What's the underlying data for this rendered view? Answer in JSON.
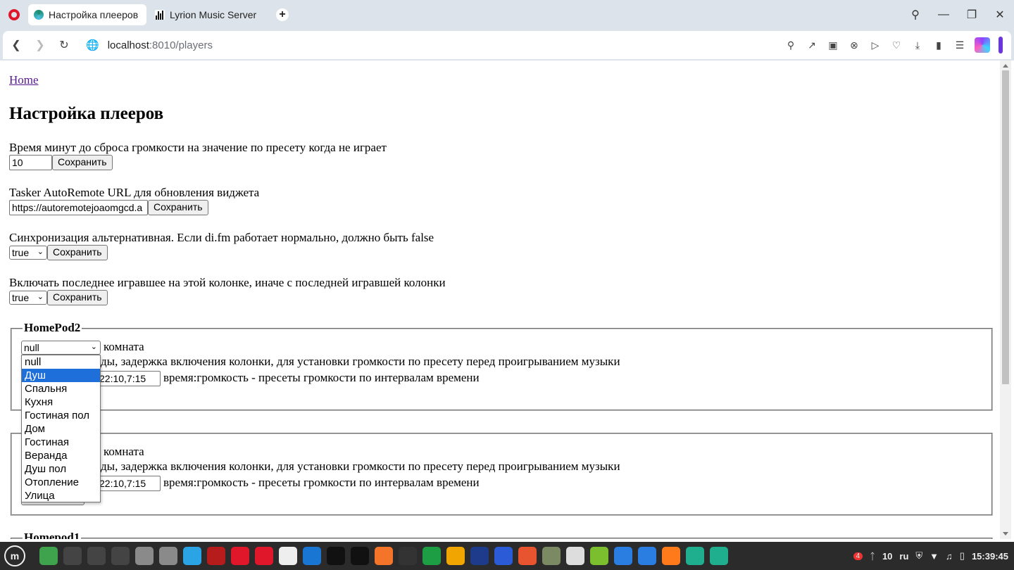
{
  "browser": {
    "tabs": [
      {
        "title": "Настройка плееров",
        "active": true
      },
      {
        "title": "Lyrion Music Server",
        "active": false
      }
    ],
    "url_host": "localhost",
    "url_rest": ":8010/players"
  },
  "page": {
    "home_link": "Home",
    "title": "Настройка плееров",
    "settings": [
      {
        "label": "Время минут до сброса громкости на значение по пресету когда не играет",
        "value": "10",
        "button": "Сохранить"
      },
      {
        "label": "Tasker AutoRemote URL для обновления виджета",
        "value": "https://autoremotejoaomgcd.a",
        "button": "Сохранить"
      },
      {
        "label": "Синхронизация альтернативная. Если di.fm работает нормально, должно быть false",
        "value": "true",
        "button": "Сохранить"
      },
      {
        "label": "Включать последнее игравшее на этой колонке, иначе с последней игравшей колонки",
        "value": "true",
        "button": "Сохранить"
      }
    ],
    "players": [
      {
        "name": "HomePod2",
        "room_value": "null",
        "room_label": "комната",
        "delay_text": "ды, задержка включения колонки, для установки громкости по пресету перед проигрыванием музыки",
        "preset_value": "22:10,7:15",
        "preset_label": "время:громкость - пресеты громкости по интервалам времени"
      },
      {
        "name": "",
        "room_label": "комната",
        "delay_text": "ды, задержка включения колонки, для установки громкости по пресету перед проигрыванием музыки",
        "preset_value": "22:10,7:15",
        "preset_label": "время:громкость - пресеты громкости по интервалам времени"
      },
      {
        "name": "Homepod1"
      }
    ],
    "room_options": [
      "null",
      "Душ",
      "Спальня",
      "Кухня",
      "Гостиная пол",
      "Дом",
      "Гостиная",
      "Веранда",
      "Душ пол",
      "Отопление",
      "Улица"
    ],
    "highlighted_option": "Душ"
  },
  "taskbar": {
    "tray_temp": "10",
    "tray_lang": "ru",
    "tray_badge": "4",
    "clock": "15:39:45",
    "icon_colors": [
      "#3fa34d",
      "#444",
      "#444",
      "#444",
      "#8a8a8a",
      "#8a8a8a",
      "#2aa4e4",
      "#b71c1c",
      "#e0162b",
      "#e0162b",
      "#eeeeee",
      "#1976d2",
      "#111",
      "#111",
      "#f4752a",
      "#333",
      "#1d9e45",
      "#f0a500",
      "#1e3a8a",
      "#2b5bd7",
      "#e8542f",
      "#7b8a62",
      "#ddd",
      "#7bbf2f",
      "#2a7de1",
      "#2a7de1",
      "#ff7a1a",
      "#1faf8f",
      "#1faf8f"
    ]
  }
}
